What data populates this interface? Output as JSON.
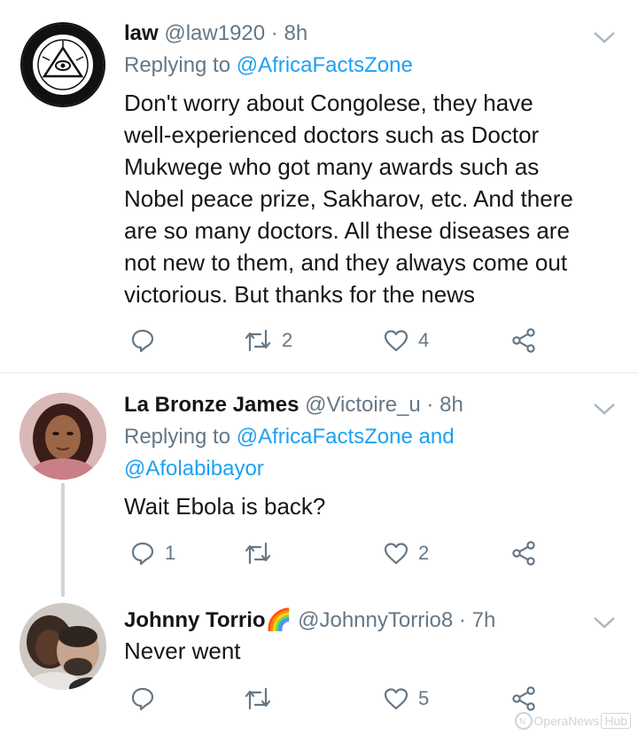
{
  "tweets": [
    {
      "name": "law",
      "handle": "@law1920",
      "dot": "·",
      "time": "8h",
      "replying_prefix": "Replying to",
      "mention1": "@AfricaFactsZone",
      "text_lines": [
        "Don't worry about Congolese, they have",
        "well-experienced doctors such as Doctor",
        "Mukwege who got many awards such as",
        "Nobel peace prize, Sakharov, etc. And there",
        "are so many doctors. All these diseases are",
        "not new to them, and they always come out",
        "victorious. But thanks for the news"
      ],
      "replies": "",
      "retweets": "2",
      "likes": "4",
      "avatar_icon": "illuminati-logo-icon"
    },
    {
      "name": "La Bronze James",
      "handle": "@Victoire_u",
      "dot": "·",
      "time": "8h",
      "replying_prefix": "Replying to",
      "mention1": "@AfricaFactsZone",
      "and": "and",
      "mention2": "@Afolabibayor",
      "text": "Wait Ebola is back?",
      "replies": "1",
      "retweets": "",
      "likes": "2",
      "avatar_icon": "profile-photo"
    },
    {
      "name": "Johnny Torrio",
      "emoji": "🌈",
      "handle": "@JohnnyTorrio8",
      "dot": "·",
      "time": "7h",
      "text": "Never went",
      "replies": "",
      "retweets": "",
      "likes": "5",
      "avatar_icon": "profile-photo"
    }
  ],
  "watermark": {
    "brand": "OperaNews",
    "hub": "Hub"
  },
  "colors": {
    "link": "#1da1f2",
    "meta": "#657786",
    "icon": "#657786",
    "divider": "#e6ecf0"
  }
}
